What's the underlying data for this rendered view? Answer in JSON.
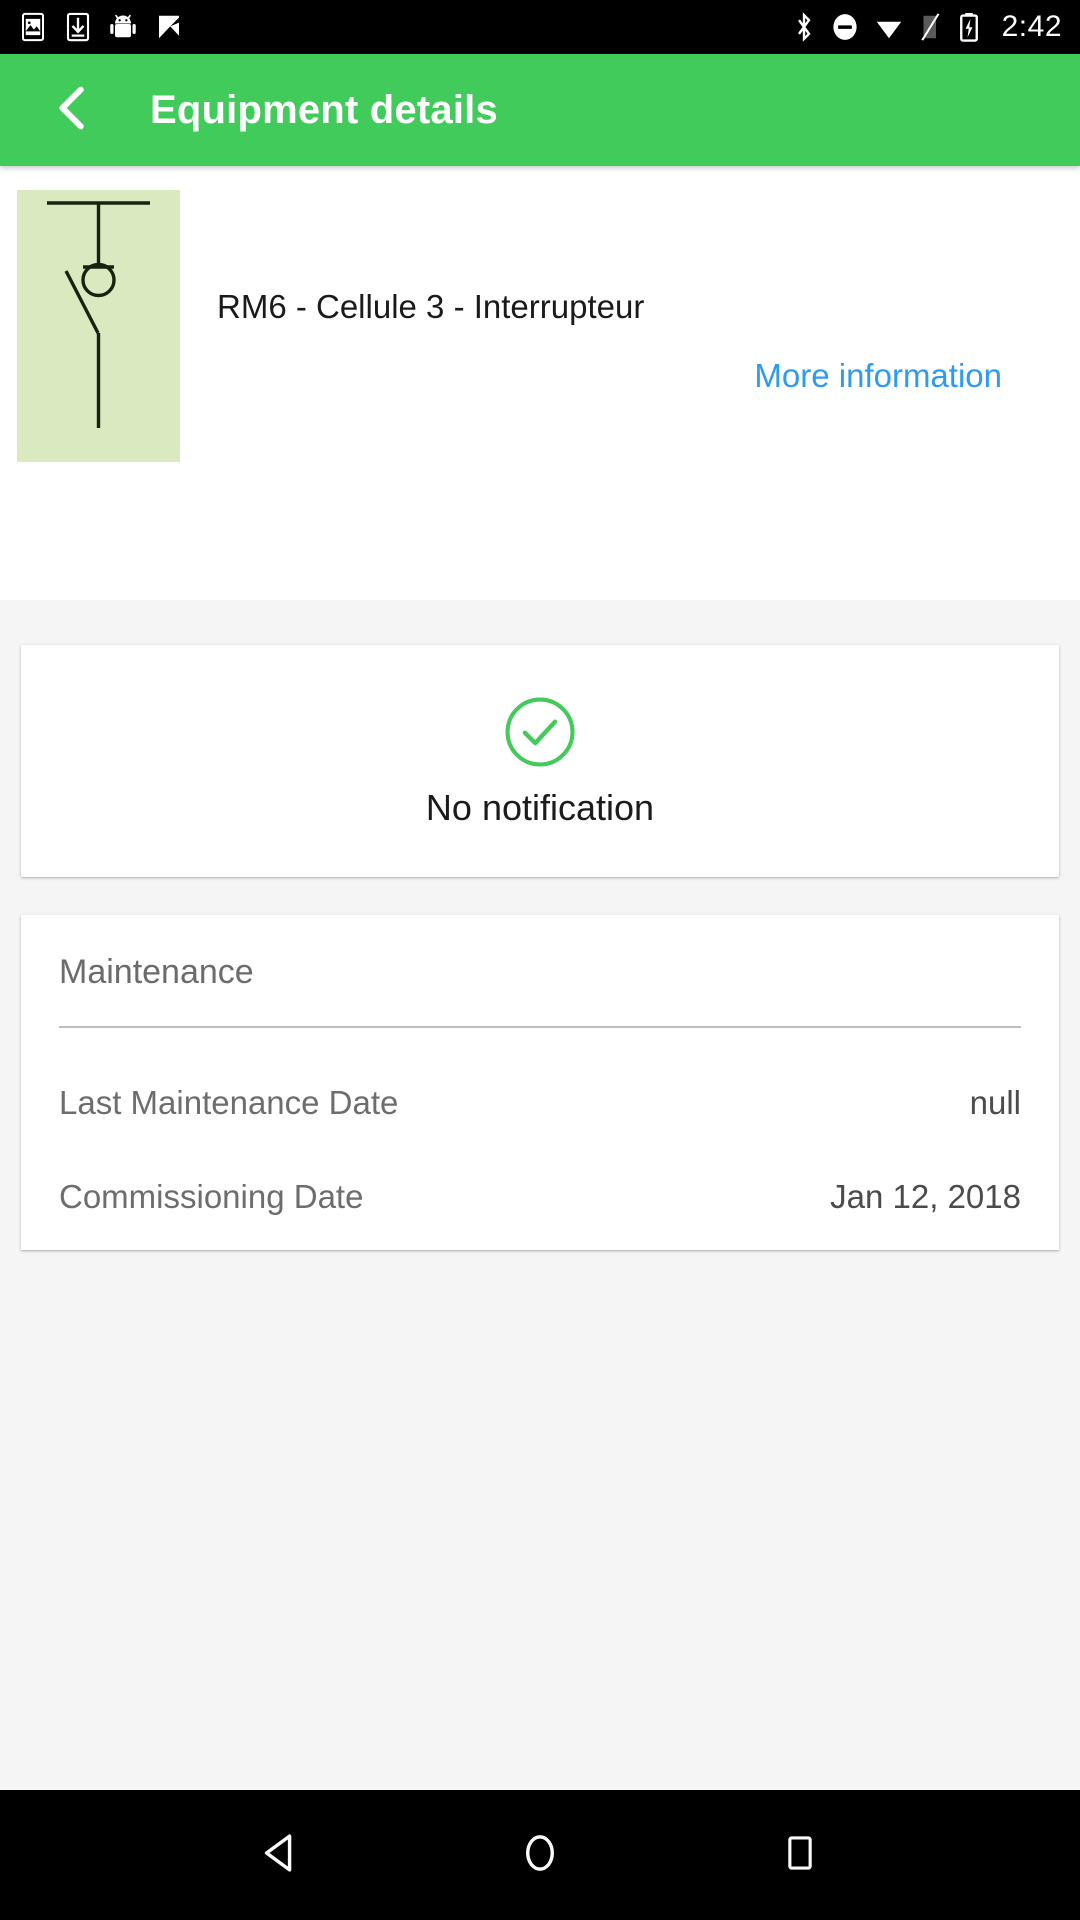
{
  "status_bar": {
    "time": "2:42",
    "left_icons": [
      "image-icon",
      "download-icon",
      "android-icon",
      "checkmark-flag-icon"
    ],
    "right_icons": [
      "bluetooth-icon",
      "do-not-disturb-icon",
      "wifi-icon",
      "signal-off-icon",
      "battery-charging-icon"
    ]
  },
  "app_bar": {
    "title": "Equipment details",
    "back_icon": "chevron-left-icon",
    "background_color": "#41cb5a"
  },
  "equipment": {
    "name": "RM6 - Cellule 3 - Interrupteur",
    "more_information_label": "More information",
    "more_information_color": "#2e9af0",
    "thumbnail": {
      "icon": "switch-disconnector-schematic",
      "background_color": "#dbe9c1",
      "line_color": "#1a2b1a"
    }
  },
  "notification_card": {
    "icon": "check-circle-icon",
    "icon_color": "#44c95c",
    "text": "No notification"
  },
  "maintenance_card": {
    "title": "Maintenance",
    "rows": [
      {
        "label": "Last Maintenance Date",
        "value": "null"
      },
      {
        "label": "Commissioning Date",
        "value": "Jan 12, 2018"
      }
    ]
  },
  "nav_bar": {
    "back_icon": "triangle-back-icon",
    "home_icon": "circle-home-icon",
    "recents_icon": "square-recents-icon"
  }
}
